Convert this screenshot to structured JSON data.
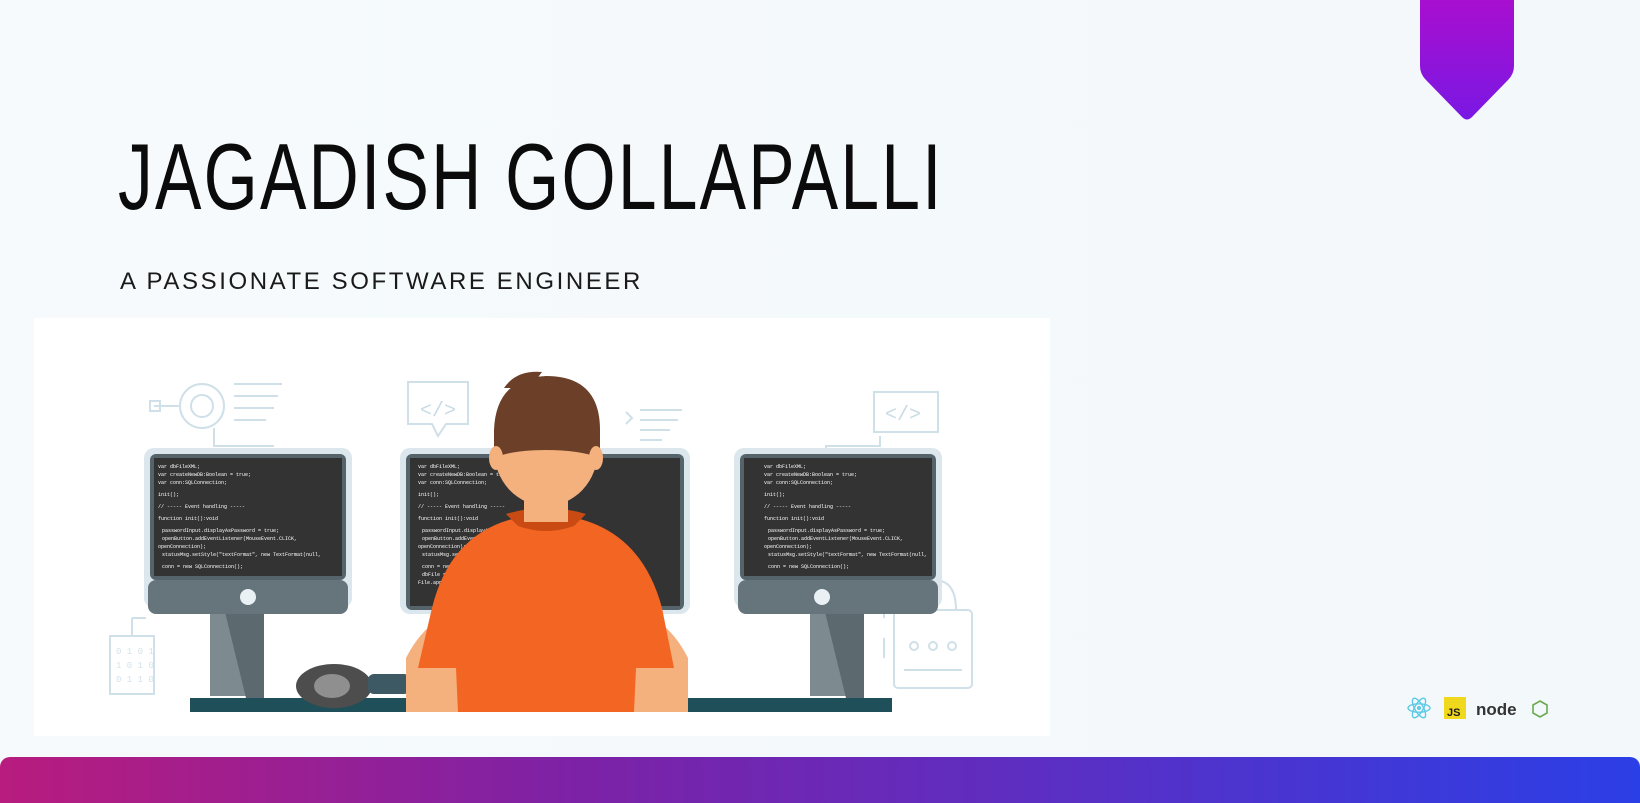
{
  "header": {
    "name": "JAGADISH GOLLAPALLI",
    "tagline": "A PASSIONATE SOFTWARE ENGINEER"
  },
  "illustration": {
    "subject": "developer-at-three-monitors",
    "code_snippet": [
      "var dbFileXML;",
      "var createNewDB:Boolean = true;",
      "var conn:SQLConnection;",
      "init();",
      "// ----- Event handling -----",
      "function init():void",
      "{",
      "  passwordInput.displayAsPassword = true;",
      "  openButton.addEventListener(MouseEvent.CLICK,",
      "openConnection);",
      "  statusMsg.setStyle(\"textFormat\", new TextFormat(null,",
      "null, 0x990000));",
      "  conn = new SQLConnection();",
      "  dbFile =",
      "File.applicationStorageDirectory.resolvePath(dbFileName);"
    ],
    "tag_glyph": "</>"
  },
  "tech_badges": {
    "js": "JS",
    "node": "node"
  },
  "colors": {
    "accent_purple": "#a00ad6",
    "bar_start": "#b81c7e",
    "bar_end": "#2b3fe6",
    "shirt": "#f26522",
    "hair": "#6b3f28",
    "skin": "#f4b07d",
    "screen": "#323232",
    "monitor_frame": "#66757c"
  }
}
